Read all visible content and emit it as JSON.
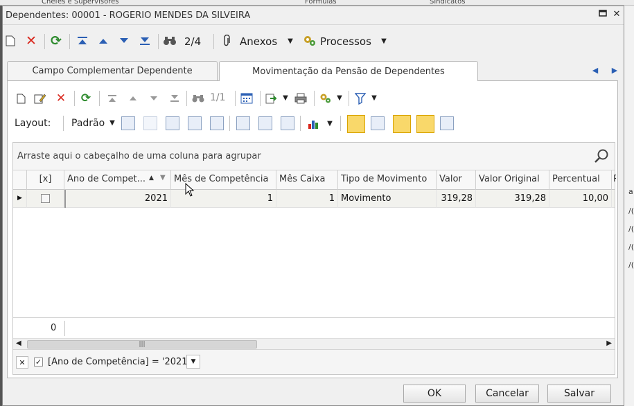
{
  "background": {
    "tabs": [
      "Chefes e Supervisores",
      "Fórmulas",
      "Sindicatos"
    ],
    "right_items": [
      "a",
      "/(",
      "/(",
      "/(",
      "/("
    ]
  },
  "window": {
    "title": "Dependentes: 00001 - ROGERIO MENDES DA SILVEIRA",
    "minimize_icon": "restore-icon",
    "close_icon": "close-icon"
  },
  "main_toolbar": {
    "record_position": "2/4",
    "attachments_label": "Anexos",
    "processes_label": "Processos"
  },
  "tabs": [
    {
      "label": "Campo Complementar Dependente",
      "active": false
    },
    {
      "label": "Movimentação da Pensão de Dependentes",
      "active": true
    }
  ],
  "sub_toolbar": {
    "record_position": "1/1"
  },
  "layout_bar": {
    "layout_label": "Layout:",
    "layout_value": "Padrão"
  },
  "grid": {
    "group_hint": "Arraste aqui o cabeçalho de uma coluna para agrupar",
    "columns": [
      "[x]",
      "Ano de Compet...",
      "Mês de Competência",
      "Mês Caixa",
      "Tipo de Movimento",
      "Valor",
      "Valor Original",
      "Percentual",
      "P"
    ],
    "rows": [
      {
        "ano": "2021",
        "mes_comp": "1",
        "mes_caixa": "1",
        "tipo": "Movimento",
        "valor": "319,28",
        "valor_original": "319,28",
        "percentual": "10,00"
      }
    ],
    "footer_count": "0",
    "filter_text": "[Ano de Competência] = '2021'"
  },
  "buttons": {
    "ok": "OK",
    "cancel": "Cancelar",
    "save": "Salvar"
  },
  "colors": {
    "accent_red": "#d9261c",
    "accent_green": "#2e8b2e",
    "accent_blue": "#2b5fb4",
    "highlight_yellow": "#f9d86a"
  }
}
